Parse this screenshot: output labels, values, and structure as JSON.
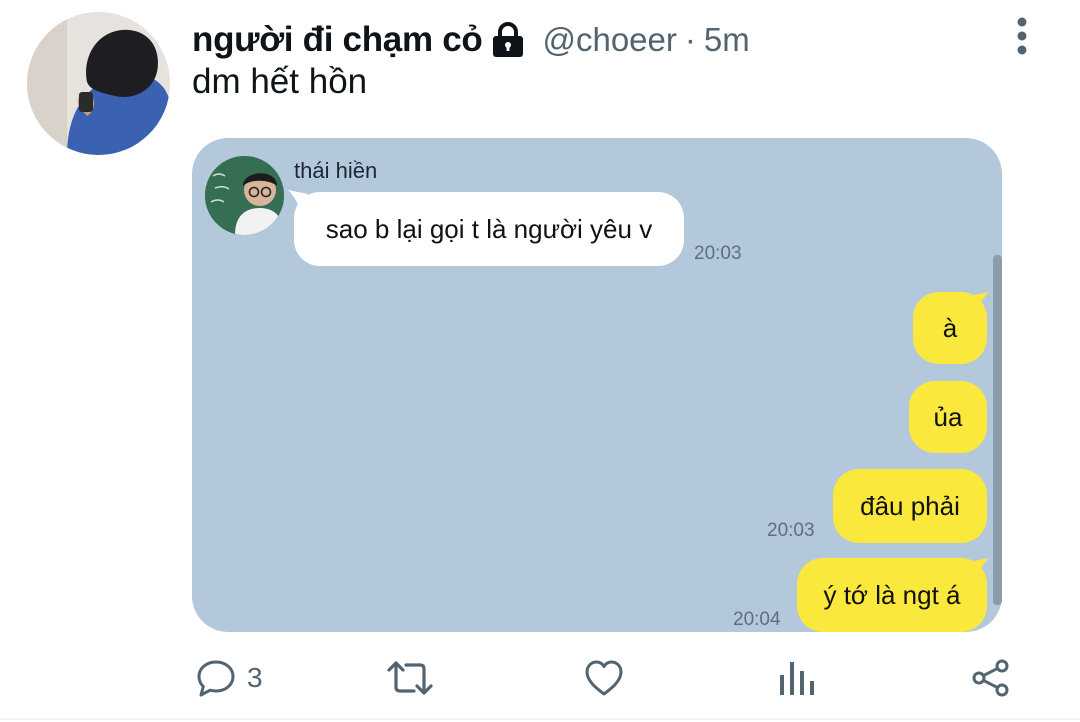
{
  "tweet": {
    "display_name": "người đi chạm cỏ",
    "handle": "@choeer",
    "separator": "·",
    "time_ago": "5m",
    "text": "dm hết hồn"
  },
  "chat": {
    "contact_name": "thái hiền",
    "messages": [
      {
        "side": "in",
        "text": "sao b lại gọi t là người yêu v",
        "time": "20:03"
      },
      {
        "side": "out",
        "text": "à",
        "time": ""
      },
      {
        "side": "out",
        "text": "ủa",
        "time": ""
      },
      {
        "side": "out",
        "text": "đâu phải",
        "time": "20:03"
      },
      {
        "side": "out",
        "text": "ý tớ là ngt á",
        "time": "20:04"
      }
    ]
  },
  "actions": {
    "reply_count": "3",
    "retweet_count": "",
    "like_count": ""
  },
  "colors": {
    "chat_background": "#b4c8dc",
    "outgoing_bubble": "#fbe83c",
    "incoming_bubble": "#ffffff",
    "secondary_text": "#536471"
  },
  "icons": {
    "lock": "lock-icon",
    "more": "more-vertical-icon",
    "reply": "reply-icon",
    "retweet": "retweet-icon",
    "like": "heart-icon",
    "views": "views-chart-icon",
    "share": "share-icon"
  }
}
